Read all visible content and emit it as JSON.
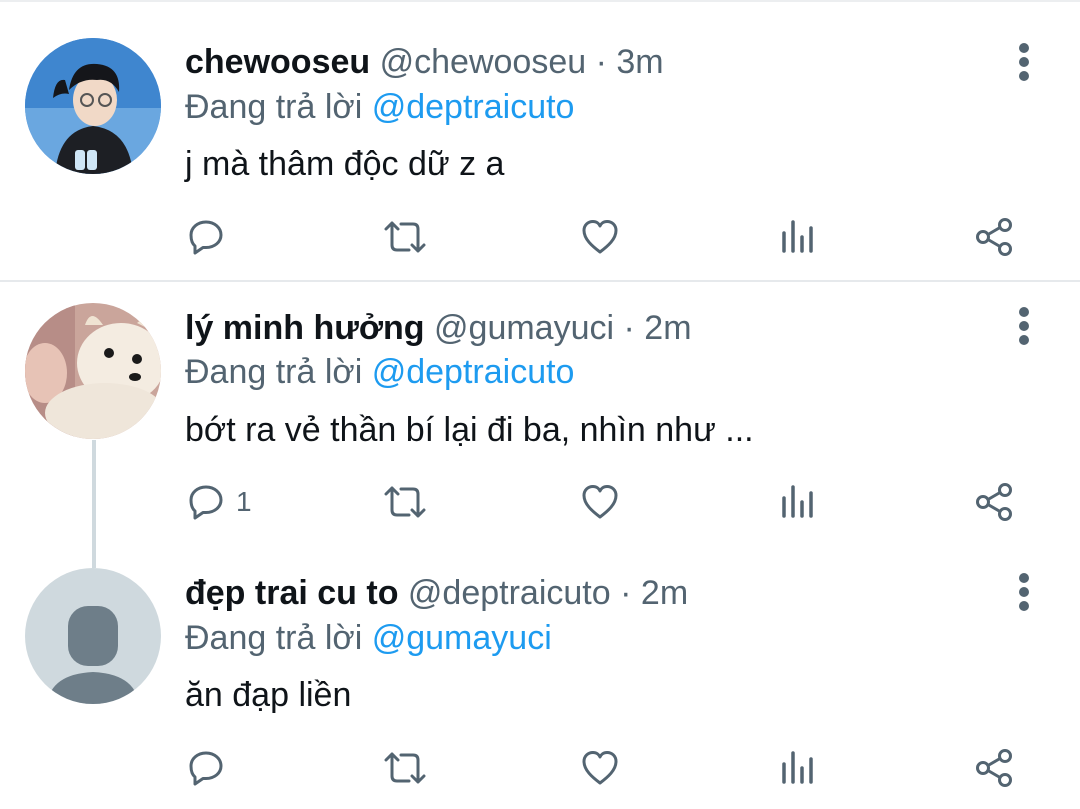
{
  "tweets": [
    {
      "name": "chewooseu",
      "handle": "@chewooseu",
      "separator": "·",
      "time": "3m",
      "replying_prefix": "Đang trả lời",
      "replying_to": "@deptraicuto",
      "text": "j mà thâm độc dữ z a",
      "reply_count": "",
      "avatar": "photo-person-icon"
    },
    {
      "name": "lý minh hưởng",
      "handle": "@gumayuci",
      "separator": "·",
      "time": "2m",
      "replying_prefix": "Đang trả lời",
      "replying_to": "@deptraicuto",
      "text": "bớt ra vẻ thần bí lại đi ba, nhìn như ...",
      "reply_count": "1",
      "avatar": "photo-dog-icon"
    },
    {
      "name": "đẹp trai cu to",
      "handle": "@deptraicuto",
      "separator": "·",
      "time": "2m",
      "replying_prefix": "Đang trả lời",
      "replying_to": "@gumayuci",
      "text": "ăn đạp liền",
      "reply_count": "",
      "avatar": "default-avatar-icon"
    }
  ],
  "colors": {
    "text": "#0f1419",
    "secondary": "#536471",
    "accent": "#1d9bf0",
    "divider": "#e6e9ec",
    "thread_line": "#cfd9de"
  },
  "action_icons": [
    "reply-icon",
    "retweet-icon",
    "like-icon",
    "analytics-icon",
    "share-icon"
  ]
}
